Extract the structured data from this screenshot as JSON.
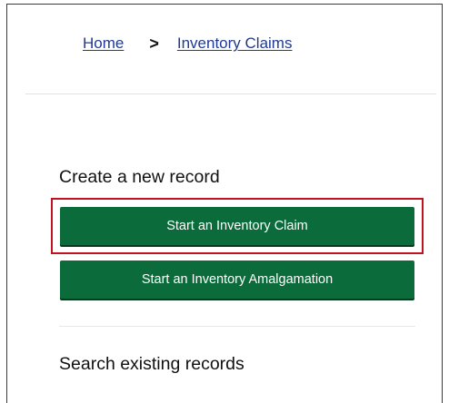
{
  "breadcrumb": {
    "home": "Home",
    "separator": ">",
    "current": "Inventory Claims"
  },
  "create": {
    "title": "Create a new record",
    "start_claim_label": "Start an Inventory Claim",
    "start_amalgamation_label": "Start an Inventory Amalgamation"
  },
  "search": {
    "title": "Search existing records"
  },
  "colors": {
    "button_green": "#0b6b3a",
    "link_blue": "#1f3a93",
    "highlight_red": "#c1121f"
  }
}
